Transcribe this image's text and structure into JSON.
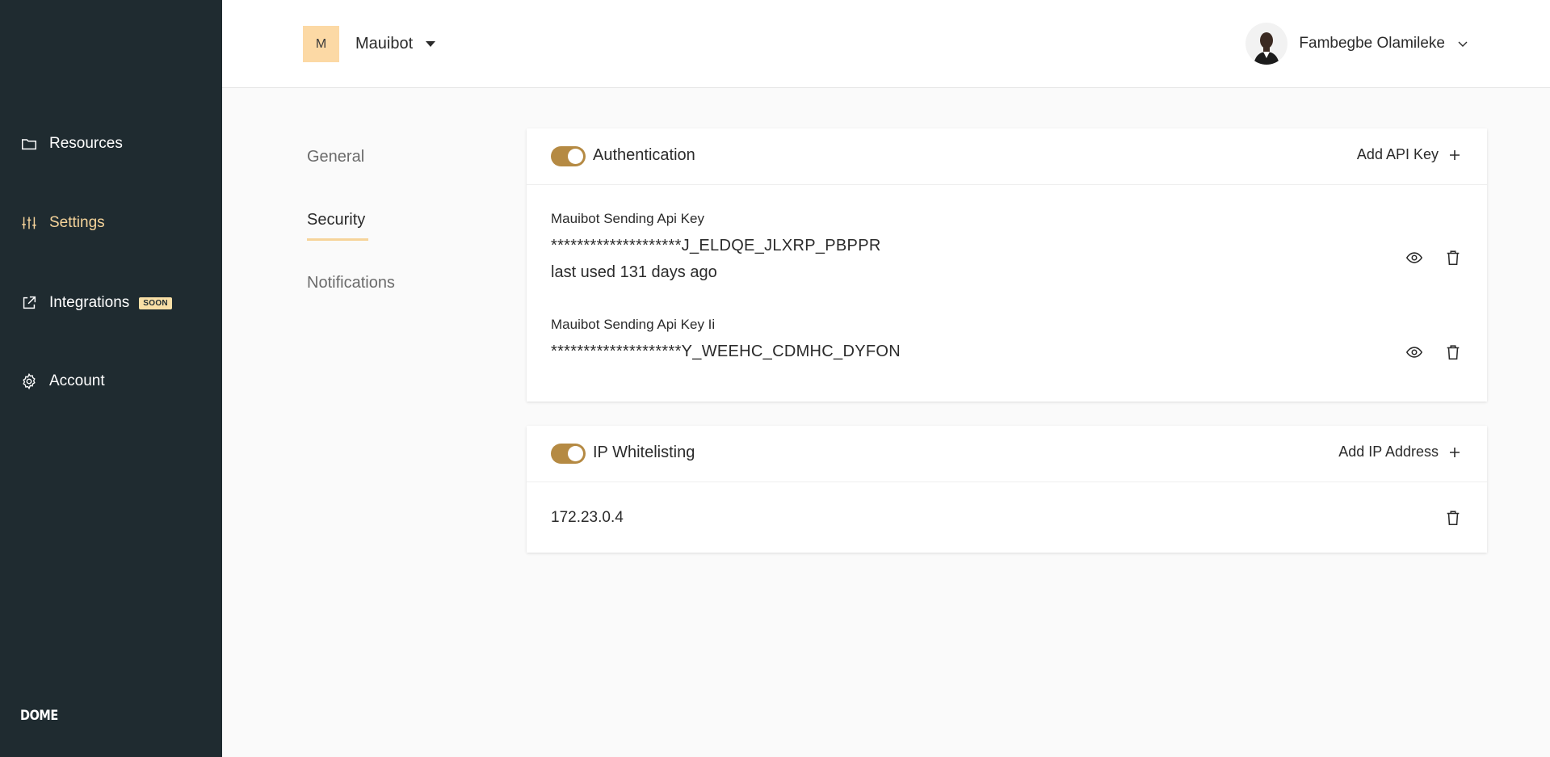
{
  "sidebar": {
    "items": [
      {
        "label": "Resources",
        "icon": "folder-icon"
      },
      {
        "label": "Settings",
        "icon": "sliders-icon",
        "active": true
      },
      {
        "label": "Integrations",
        "icon": "external-link-icon",
        "badge": "SOON"
      },
      {
        "label": "Account",
        "icon": "gear-icon"
      }
    ],
    "brand": "DOME"
  },
  "header": {
    "org_initial": "M",
    "org_name": "Mauibot",
    "user_name": "Fambegbe Olamileke"
  },
  "tabs": [
    {
      "label": "General"
    },
    {
      "label": "Security",
      "active": true
    },
    {
      "label": "Notifications"
    }
  ],
  "authentication": {
    "title": "Authentication",
    "add_label": "Add API Key",
    "enabled": true,
    "keys": [
      {
        "name": "Mauibot Sending Api Key",
        "value": "********************J_ELDQE_JLXRP_PBPPR",
        "last_used": "last used 131 days ago"
      },
      {
        "name": "Mauibot Sending Api Key Ii",
        "value": "********************Y_WEEHC_CDMHC_DYFON"
      }
    ]
  },
  "ip_whitelisting": {
    "title": "IP Whitelisting",
    "add_label": "Add IP Address",
    "enabled": true,
    "addresses": [
      "172.23.0.4"
    ]
  },
  "colors": {
    "sidebar_bg": "#1f2b30",
    "accent": "#f6d49a",
    "toggle_on": "#b58a43",
    "org_avatar_bg": "#fcd9a5"
  }
}
